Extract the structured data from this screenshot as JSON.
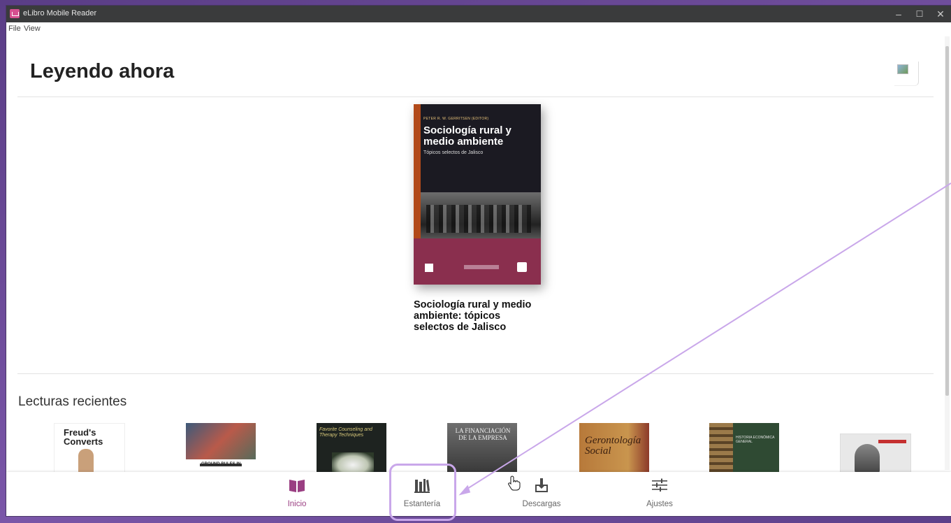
{
  "window": {
    "title": "eLibro Mobile Reader",
    "controls": {
      "minimize": "–",
      "maximize": "☐",
      "close": "✕"
    }
  },
  "menu": {
    "items": [
      "File",
      "View"
    ]
  },
  "header": {
    "title": "Leyendo ahora"
  },
  "current_book": {
    "cover": {
      "author": "PETER R. W. GERRITSEN (EDITOR)",
      "title": "Sociología rural y medio ambiente",
      "subtitle": "Tópicos selectos de Jalisco"
    },
    "caption": "Sociología rural y medio ambiente: tópicos selectos de Jalisco"
  },
  "recent": {
    "title": "Lecturas recientes",
    "books": [
      {
        "cover_text": "Freud's Converts"
      },
      {
        "cover_text": "GROUND RULES IN"
      },
      {
        "cover_text": "Favorite Counseling and Therapy Techniques"
      },
      {
        "cover_text": "LA FINANCIACIÓN DE LA EMPRESA"
      },
      {
        "cover_text": "Gerontología Social"
      },
      {
        "cover_text": "HISTORIA ECONÓMICA GENERAL"
      },
      {
        "cover_text": ""
      }
    ]
  },
  "navbar": {
    "items": [
      {
        "label": "Inicio",
        "icon": "book-open-icon",
        "active": true
      },
      {
        "label": "Estantería",
        "icon": "bookshelf-icon",
        "active": false
      },
      {
        "label": "Descargas",
        "icon": "download-icon",
        "active": false
      },
      {
        "label": "Ajustes",
        "icon": "sliders-icon",
        "active": false
      }
    ]
  },
  "colors": {
    "accent": "#9a3e82",
    "annotation": "#c9a7ea",
    "desktop": "#6c4b9a",
    "titlebar": "#3a3b3c"
  }
}
